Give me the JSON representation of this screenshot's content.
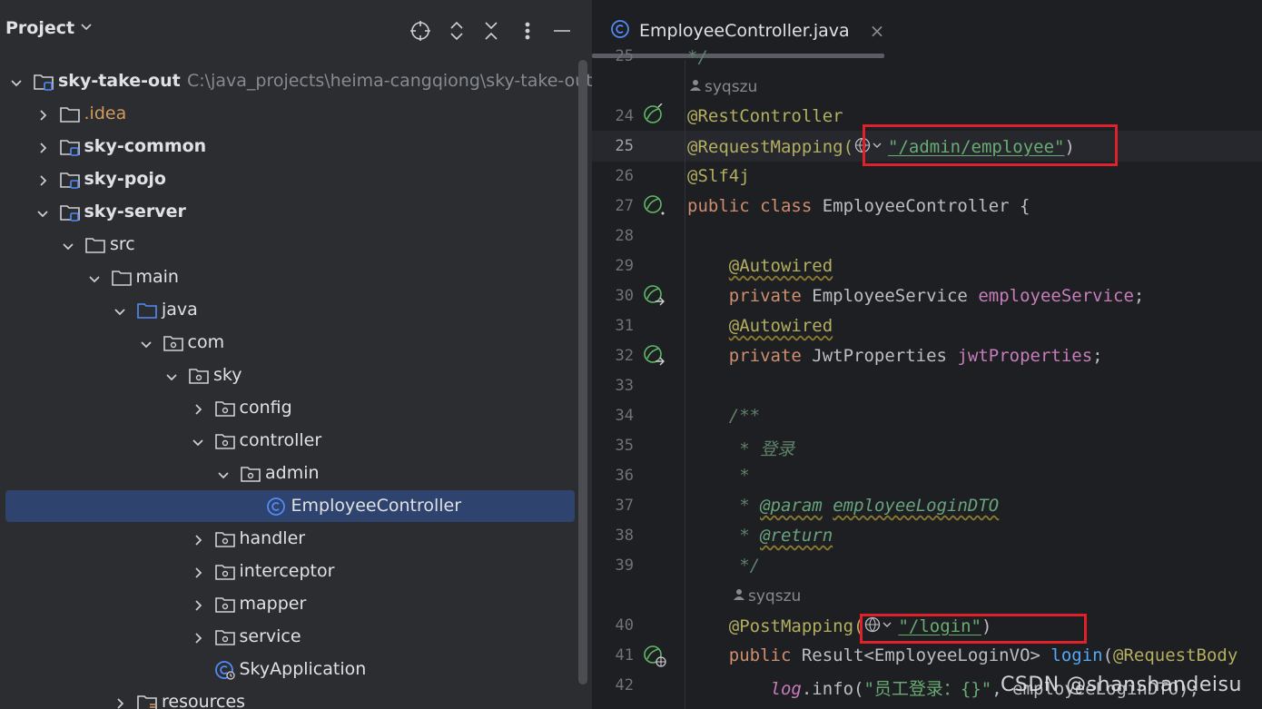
{
  "project_panel": {
    "title": "Project",
    "tree": [
      {
        "label": "sky-take-out",
        "path": "C:\\java_projects\\heima-cangqiong\\sky-take-out",
        "bold": true
      },
      {
        "label": ".idea"
      },
      {
        "label": "sky-common",
        "bold": true
      },
      {
        "label": "sky-pojo",
        "bold": true
      },
      {
        "label": "sky-server",
        "bold": true
      },
      {
        "label": "src"
      },
      {
        "label": "main"
      },
      {
        "label": "java"
      },
      {
        "label": "com"
      },
      {
        "label": "sky"
      },
      {
        "label": "config"
      },
      {
        "label": "controller"
      },
      {
        "label": "admin"
      },
      {
        "label": "EmployeeController",
        "selected": true
      },
      {
        "label": "handler"
      },
      {
        "label": "interceptor"
      },
      {
        "label": "mapper"
      },
      {
        "label": "service"
      },
      {
        "label": "SkyApplication"
      },
      {
        "label": "resources"
      }
    ]
  },
  "editor": {
    "tab_label": "EmployeeController.java",
    "authors": [
      "syqszu",
      "syqszu"
    ],
    "line_numbers": [
      "25",
      "24",
      "25",
      "26",
      "27",
      "28",
      "29",
      "30",
      "31",
      "32",
      "33",
      "34",
      "35",
      "36",
      "37",
      "38",
      "39",
      "40",
      "41",
      "42"
    ],
    "code": {
      "l23": "*/",
      "l24": "@RestController",
      "l25_a": "@RequestMapping(",
      "l25_b": "\"/admin/employee\"",
      "l25_c": ")",
      "l26": "@Slf4j",
      "l27_kw": "public class",
      "l27_rest": " EmployeeController {",
      "l29": "@Autowired",
      "l30_kw": "private",
      "l30_type": " EmployeeService ",
      "l30_field": "employeeService",
      "l30_end": ";",
      "l31": "@Autowired",
      "l32_kw": "private",
      "l32_type": " JwtProperties ",
      "l32_field": "jwtProperties",
      "l32_end": ";",
      "l34": "/**",
      "l35": " * 登录",
      "l36": " *",
      "l37_a": " * ",
      "l37_tag": "@param",
      "l37_b": " ",
      "l37_c": "employeeLoginDTO",
      "l38_a": " * ",
      "l38_tag": "@return",
      "l39": " */",
      "l40_a": "@PostMapping(",
      "l40_b": "\"/login\"",
      "l40_c": ")",
      "l41_kw": "public",
      "l41_type": " Result<EmployeeLoginVO> ",
      "l41_method": "login",
      "l41_rest": "(",
      "l41_ann": "@RequestBody",
      "l42_stat": "log",
      "l42_a": ".info(",
      "l42_str": "\"员工登录：{}\"",
      "l42_b": ", employeeLoginDTO);"
    },
    "watermark": "CSDN @shanshandeisu"
  },
  "colors": {
    "highlight_box": "#e0202a",
    "selection": "#2e436e"
  }
}
